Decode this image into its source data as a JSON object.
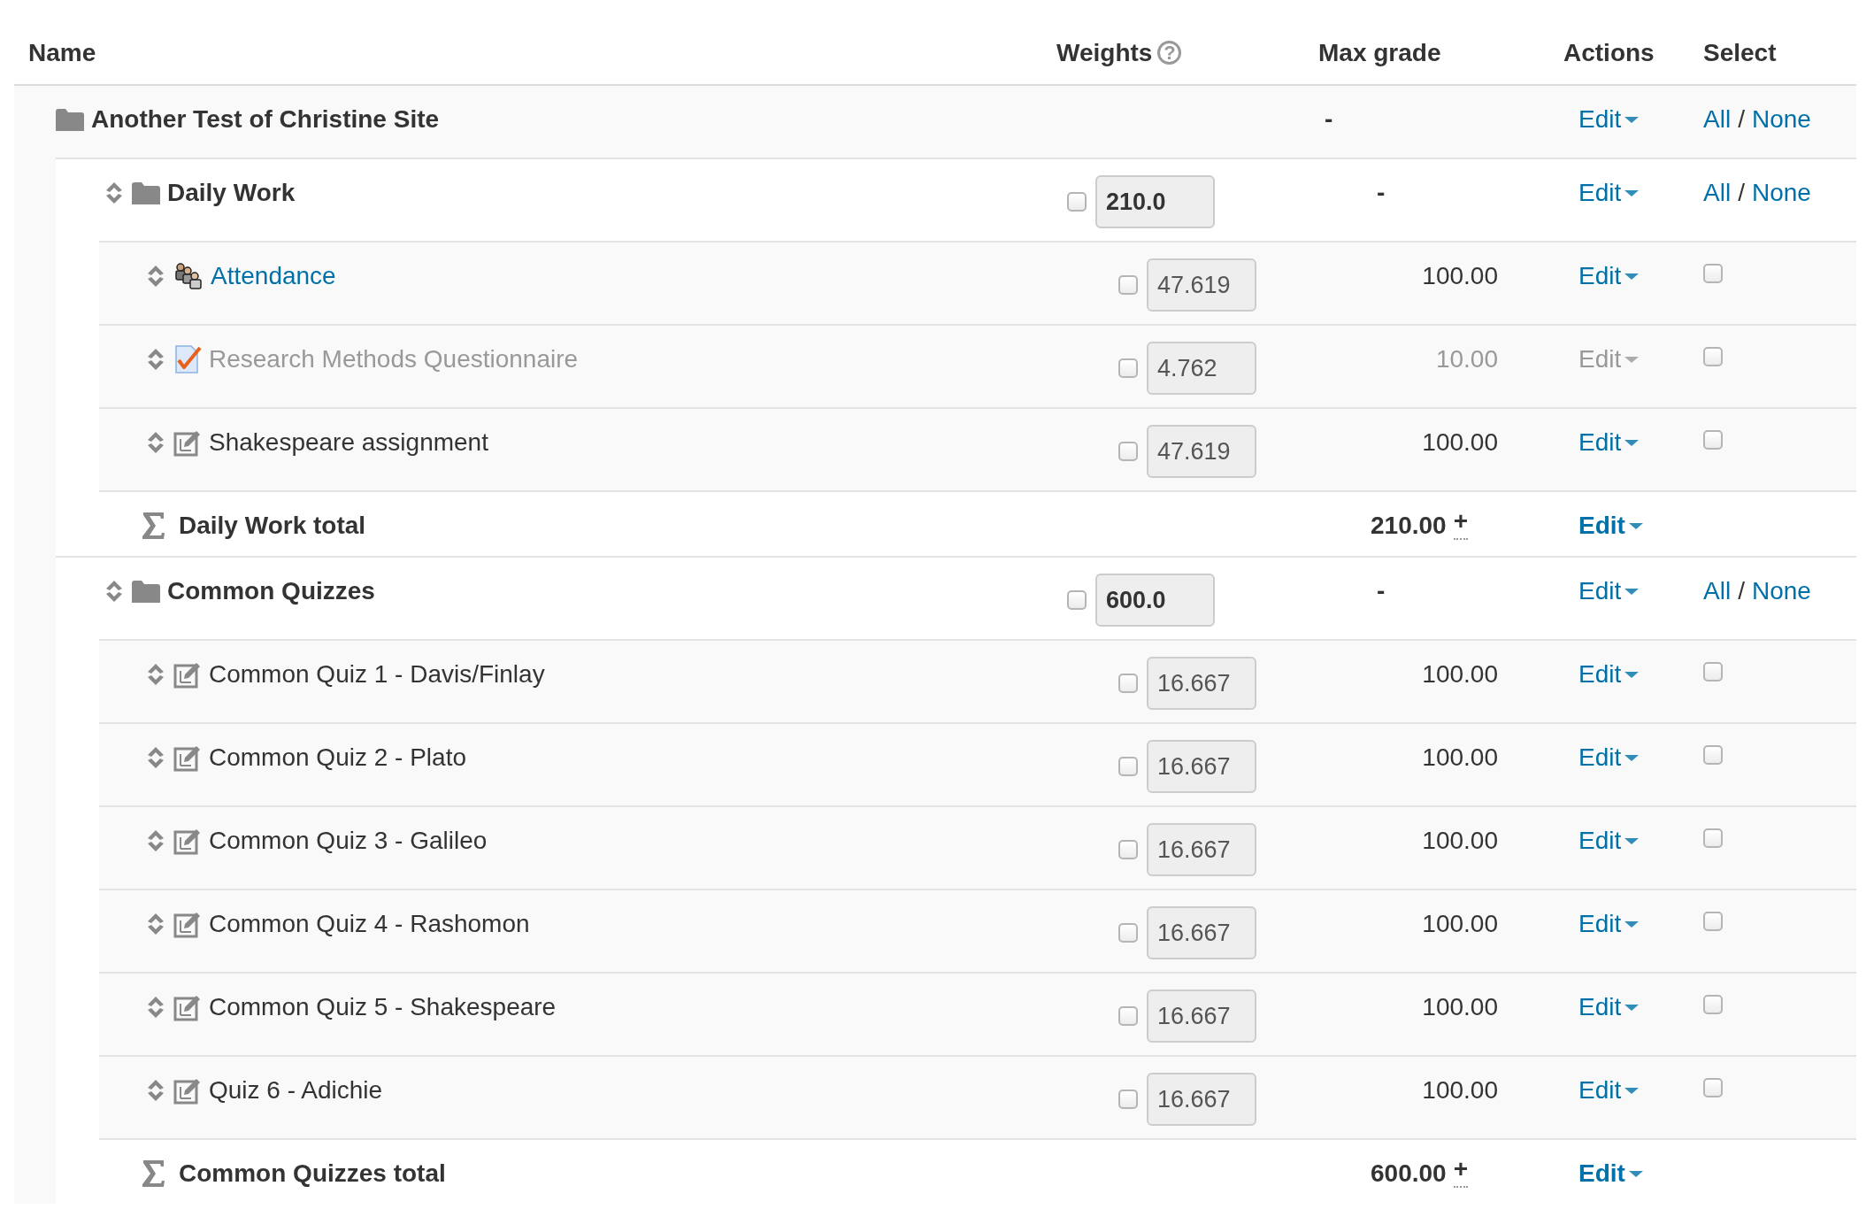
{
  "table": {
    "columns": [
      {
        "label": "Name"
      },
      {
        "label": "Weights",
        "help": "?"
      },
      {
        "label": "Max grade"
      },
      {
        "label": "Actions"
      },
      {
        "label": "Select"
      }
    ],
    "root": {
      "name": "Another Test of Christine Site",
      "max_grade": "-",
      "action": "Edit",
      "select_all": "All",
      "separator": "/",
      "select_none": "None",
      "children": [
        {
          "name": "Daily Work",
          "weight_checked": false,
          "weight": "210.0",
          "max_grade": "-",
          "action": "Edit",
          "select_all": "All",
          "separator": "/",
          "select_none": "None",
          "items": [
            {
              "kind": "attendance",
              "name": "Attendance",
              "link": true,
              "hidden": false,
              "weight_checked": false,
              "weight": "47.619",
              "max_grade": "100.00",
              "action": "Edit",
              "selected": false
            },
            {
              "kind": "questionnaire",
              "name": "Research Methods Questionnaire",
              "link": false,
              "hidden": true,
              "weight_checked": false,
              "weight": "4.762",
              "max_grade": "10.00",
              "action": "Edit",
              "selected": false
            },
            {
              "kind": "assignment",
              "name": "Shakespeare assignment",
              "link": false,
              "hidden": false,
              "weight_checked": false,
              "weight": "47.619",
              "max_grade": "100.00",
              "action": "Edit",
              "selected": false
            }
          ],
          "total": {
            "name": "Daily Work total",
            "max_grade": "210.00",
            "extra": "+",
            "action": "Edit"
          }
        },
        {
          "name": "Common Quizzes",
          "weight_checked": false,
          "weight": "600.0",
          "max_grade": "-",
          "action": "Edit",
          "select_all": "All",
          "separator": "/",
          "select_none": "None",
          "items": [
            {
              "kind": "assignment",
              "name": "Common Quiz 1 - Davis/Finlay",
              "link": false,
              "hidden": false,
              "weight_checked": false,
              "weight": "16.667",
              "max_grade": "100.00",
              "action": "Edit",
              "selected": false
            },
            {
              "kind": "assignment",
              "name": "Common Quiz 2 - Plato",
              "link": false,
              "hidden": false,
              "weight_checked": false,
              "weight": "16.667",
              "max_grade": "100.00",
              "action": "Edit",
              "selected": false
            },
            {
              "kind": "assignment",
              "name": "Common Quiz 3 - Galileo",
              "link": false,
              "hidden": false,
              "weight_checked": false,
              "weight": "16.667",
              "max_grade": "100.00",
              "action": "Edit",
              "selected": false
            },
            {
              "kind": "assignment",
              "name": "Common Quiz 4 - Rashomon",
              "link": false,
              "hidden": false,
              "weight_checked": false,
              "weight": "16.667",
              "max_grade": "100.00",
              "action": "Edit",
              "selected": false
            },
            {
              "kind": "assignment",
              "name": "Common Quiz 5 - Shakespeare",
              "link": false,
              "hidden": false,
              "weight_checked": false,
              "weight": "16.667",
              "max_grade": "100.00",
              "action": "Edit",
              "selected": false
            },
            {
              "kind": "assignment",
              "name": "Quiz 6 - Adichie",
              "link": false,
              "hidden": false,
              "weight_checked": false,
              "weight": "16.667",
              "max_grade": "100.00",
              "action": "Edit",
              "selected": false
            }
          ],
          "total": {
            "name": "Common Quizzes total",
            "max_grade": "600.00",
            "extra": "+",
            "action": "Edit"
          }
        }
      ]
    }
  }
}
